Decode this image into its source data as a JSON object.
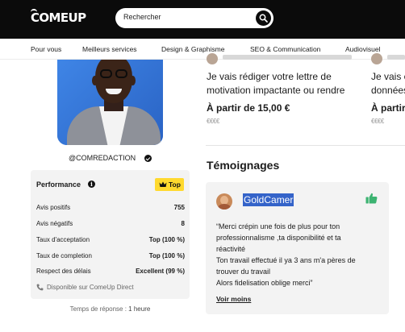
{
  "header": {
    "logo": "COMEUP",
    "search": {
      "placeholder": "Rechercher"
    }
  },
  "nav": {
    "items": [
      "Pour vous",
      "Meilleurs services",
      "Design & Graphisme",
      "SEO & Communication",
      "Audiovisuel"
    ]
  },
  "profile": {
    "username": "@COMREDACTION"
  },
  "performance": {
    "title": "Performance",
    "badge": "Top",
    "stats": [
      {
        "label": "Avis positifs",
        "value": "755"
      },
      {
        "label": "Avis négatifs",
        "value": "8"
      },
      {
        "label": "Taux d'acceptation",
        "value": "Top (100 %)"
      },
      {
        "label": "Taux de completion",
        "value": "Top (100 %)"
      },
      {
        "label": "Respect des délais",
        "value": "Excellent (99 %)"
      }
    ],
    "direct": "Disponible sur ComeUp Direct",
    "response_label": "Temps de réponse :",
    "response_value": "1 heure"
  },
  "services": [
    {
      "title_line1": "Je vais rédiger votre lettre de",
      "title_line2": "motivation impactante ou rendre",
      "price": "À partir de 15,00 €",
      "currency_level": "€€€€"
    },
    {
      "title_line1": "Je vais e",
      "title_line2": "données",
      "price": "À partir",
      "currency_level": "€€€€"
    }
  ],
  "testimonials": {
    "title": "Témoignages",
    "items": [
      {
        "name": "GoldCamer",
        "lines": [
          "“Merci crépin une fois de plus pour ton",
          "professionnalisme ,ta disponibilité et ta",
          "réactivité",
          "Ton travail effectué il ya 3 ans m'a pères de",
          "trouver du travail",
          "Alors fidelisation oblige merci”"
        ],
        "see_more": "Voir moins"
      }
    ]
  },
  "colors": {
    "header_bg": "#0b0b0b",
    "badge_yellow": "#ffd92e",
    "thumb_green": "#3cb371",
    "highlight_blue": "#3463c9",
    "card_bg": "#f3f3f3"
  },
  "icons": [
    "search-icon",
    "verified-icon",
    "info-icon",
    "crown-icon",
    "phone-icon",
    "thumbs-up-icon"
  ]
}
